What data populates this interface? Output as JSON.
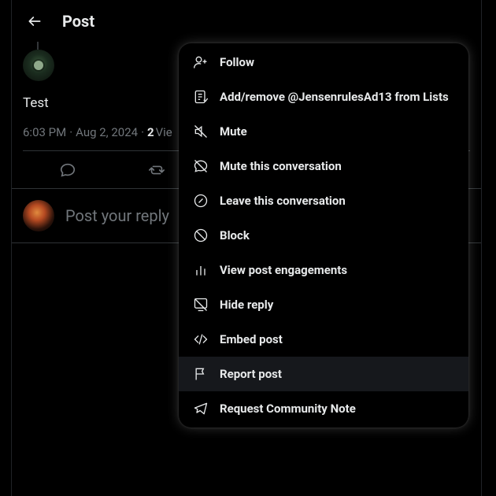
{
  "header": {
    "title": "Post"
  },
  "post": {
    "text": "Test",
    "time": "6:03 PM",
    "sep": "·",
    "date": "Aug 2, 2024",
    "views_count": "2",
    "views_label": "Vie"
  },
  "reply": {
    "placeholder": "Post your reply"
  },
  "menu": {
    "items": [
      {
        "icon": "follow",
        "label": "Follow",
        "highlight": false
      },
      {
        "icon": "list",
        "label": "Add/remove @JensenrulesAd13 from Lists",
        "highlight": false
      },
      {
        "icon": "mute",
        "label": "Mute",
        "highlight": false
      },
      {
        "icon": "mute-convo",
        "label": "Mute this conversation",
        "highlight": false
      },
      {
        "icon": "leave",
        "label": "Leave this conversation",
        "highlight": false
      },
      {
        "icon": "block",
        "label": "Block",
        "highlight": false
      },
      {
        "icon": "engagements",
        "label": "View post engagements",
        "highlight": false
      },
      {
        "icon": "hide",
        "label": "Hide reply",
        "highlight": false
      },
      {
        "icon": "embed",
        "label": "Embed post",
        "highlight": false
      },
      {
        "icon": "report",
        "label": "Report post",
        "highlight": true
      },
      {
        "icon": "note",
        "label": "Request Community Note",
        "highlight": false
      }
    ]
  }
}
